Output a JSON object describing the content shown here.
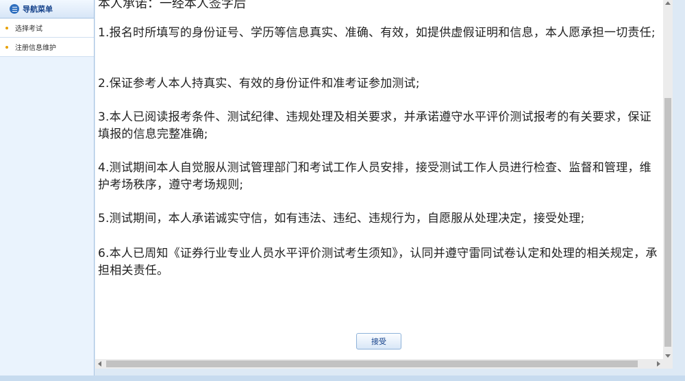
{
  "sidebar": {
    "title": "导航菜单",
    "items": [
      {
        "label": "选择考试"
      },
      {
        "label": "注册信息维护"
      }
    ]
  },
  "content": {
    "top_partial": "本人承诺：一经本人签字后",
    "clauses": [
      "1.报名时所填写的身份证号、学历等信息真实、准确、有效，如提供虚假证明和信息，本人愿承担一切责任;",
      "2.保证参考人本人持真实、有效的身份证件和准考证参加测试;",
      "3.本人已阅读报考条件、测试纪律、违规处理及相关要求，并承诺遵守水平评价测试报考的有关要求，保证填报的信息完整准确;",
      "4.测试期间本人自觉服从测试管理部门和考试工作人员安排，接受测试工作人员进行检查、监督和管理，维护考场秩序，遵守考场规则;",
      "5.测试期间，本人承诺诚实守信，如有违法、违纪、违规行为，自愿服从处理决定，接受处理;",
      "6.本人已周知《证券行业专业人员水平评价测试考生须知》，认同并遵守雷同试卷认定和处理的相关规定，承担相关责任。"
    ],
    "accept_label": "接受"
  },
  "colors": {
    "accent": "#15428b",
    "bullet": "#e8a000",
    "panel_bg": "#ffffff",
    "frame_bg": "#dde9f5"
  },
  "icons": {
    "menu": "menu-icon",
    "bullet": "bullet-icon"
  }
}
